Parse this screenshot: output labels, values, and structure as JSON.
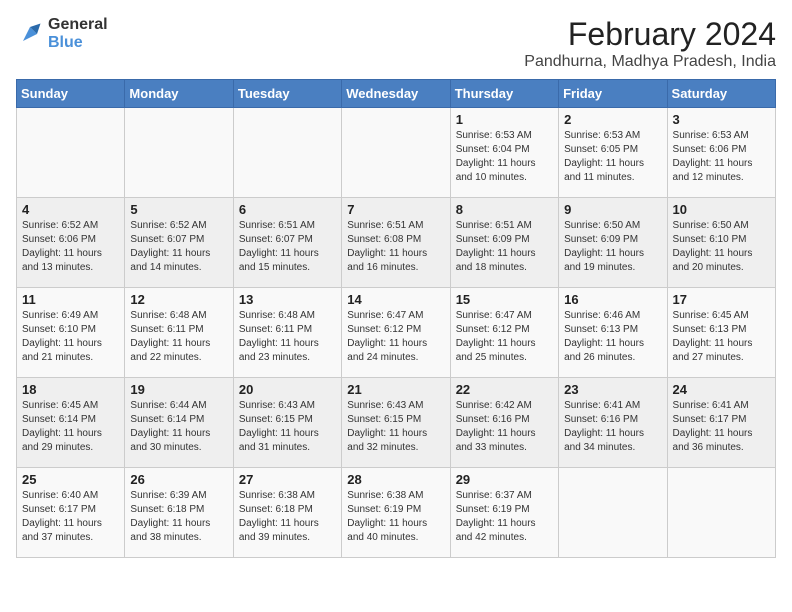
{
  "logo": {
    "line1": "General",
    "line2": "Blue"
  },
  "title": "February 2024",
  "subtitle": "Pandhurna, Madhya Pradesh, India",
  "days_of_week": [
    "Sunday",
    "Monday",
    "Tuesday",
    "Wednesday",
    "Thursday",
    "Friday",
    "Saturday"
  ],
  "weeks": [
    [
      {
        "day": "",
        "info": ""
      },
      {
        "day": "",
        "info": ""
      },
      {
        "day": "",
        "info": ""
      },
      {
        "day": "",
        "info": ""
      },
      {
        "day": "1",
        "info": "Sunrise: 6:53 AM\nSunset: 6:04 PM\nDaylight: 11 hours and 10 minutes."
      },
      {
        "day": "2",
        "info": "Sunrise: 6:53 AM\nSunset: 6:05 PM\nDaylight: 11 hours and 11 minutes."
      },
      {
        "day": "3",
        "info": "Sunrise: 6:53 AM\nSunset: 6:06 PM\nDaylight: 11 hours and 12 minutes."
      }
    ],
    [
      {
        "day": "4",
        "info": "Sunrise: 6:52 AM\nSunset: 6:06 PM\nDaylight: 11 hours and 13 minutes."
      },
      {
        "day": "5",
        "info": "Sunrise: 6:52 AM\nSunset: 6:07 PM\nDaylight: 11 hours and 14 minutes."
      },
      {
        "day": "6",
        "info": "Sunrise: 6:51 AM\nSunset: 6:07 PM\nDaylight: 11 hours and 15 minutes."
      },
      {
        "day": "7",
        "info": "Sunrise: 6:51 AM\nSunset: 6:08 PM\nDaylight: 11 hours and 16 minutes."
      },
      {
        "day": "8",
        "info": "Sunrise: 6:51 AM\nSunset: 6:09 PM\nDaylight: 11 hours and 18 minutes."
      },
      {
        "day": "9",
        "info": "Sunrise: 6:50 AM\nSunset: 6:09 PM\nDaylight: 11 hours and 19 minutes."
      },
      {
        "day": "10",
        "info": "Sunrise: 6:50 AM\nSunset: 6:10 PM\nDaylight: 11 hours and 20 minutes."
      }
    ],
    [
      {
        "day": "11",
        "info": "Sunrise: 6:49 AM\nSunset: 6:10 PM\nDaylight: 11 hours and 21 minutes."
      },
      {
        "day": "12",
        "info": "Sunrise: 6:48 AM\nSunset: 6:11 PM\nDaylight: 11 hours and 22 minutes."
      },
      {
        "day": "13",
        "info": "Sunrise: 6:48 AM\nSunset: 6:11 PM\nDaylight: 11 hours and 23 minutes."
      },
      {
        "day": "14",
        "info": "Sunrise: 6:47 AM\nSunset: 6:12 PM\nDaylight: 11 hours and 24 minutes."
      },
      {
        "day": "15",
        "info": "Sunrise: 6:47 AM\nSunset: 6:12 PM\nDaylight: 11 hours and 25 minutes."
      },
      {
        "day": "16",
        "info": "Sunrise: 6:46 AM\nSunset: 6:13 PM\nDaylight: 11 hours and 26 minutes."
      },
      {
        "day": "17",
        "info": "Sunrise: 6:45 AM\nSunset: 6:13 PM\nDaylight: 11 hours and 27 minutes."
      }
    ],
    [
      {
        "day": "18",
        "info": "Sunrise: 6:45 AM\nSunset: 6:14 PM\nDaylight: 11 hours and 29 minutes."
      },
      {
        "day": "19",
        "info": "Sunrise: 6:44 AM\nSunset: 6:14 PM\nDaylight: 11 hours and 30 minutes."
      },
      {
        "day": "20",
        "info": "Sunrise: 6:43 AM\nSunset: 6:15 PM\nDaylight: 11 hours and 31 minutes."
      },
      {
        "day": "21",
        "info": "Sunrise: 6:43 AM\nSunset: 6:15 PM\nDaylight: 11 hours and 32 minutes."
      },
      {
        "day": "22",
        "info": "Sunrise: 6:42 AM\nSunset: 6:16 PM\nDaylight: 11 hours and 33 minutes."
      },
      {
        "day": "23",
        "info": "Sunrise: 6:41 AM\nSunset: 6:16 PM\nDaylight: 11 hours and 34 minutes."
      },
      {
        "day": "24",
        "info": "Sunrise: 6:41 AM\nSunset: 6:17 PM\nDaylight: 11 hours and 36 minutes."
      }
    ],
    [
      {
        "day": "25",
        "info": "Sunrise: 6:40 AM\nSunset: 6:17 PM\nDaylight: 11 hours and 37 minutes."
      },
      {
        "day": "26",
        "info": "Sunrise: 6:39 AM\nSunset: 6:18 PM\nDaylight: 11 hours and 38 minutes."
      },
      {
        "day": "27",
        "info": "Sunrise: 6:38 AM\nSunset: 6:18 PM\nDaylight: 11 hours and 39 minutes."
      },
      {
        "day": "28",
        "info": "Sunrise: 6:38 AM\nSunset: 6:19 PM\nDaylight: 11 hours and 40 minutes."
      },
      {
        "day": "29",
        "info": "Sunrise: 6:37 AM\nSunset: 6:19 PM\nDaylight: 11 hours and 42 minutes."
      },
      {
        "day": "",
        "info": ""
      },
      {
        "day": "",
        "info": ""
      }
    ]
  ]
}
